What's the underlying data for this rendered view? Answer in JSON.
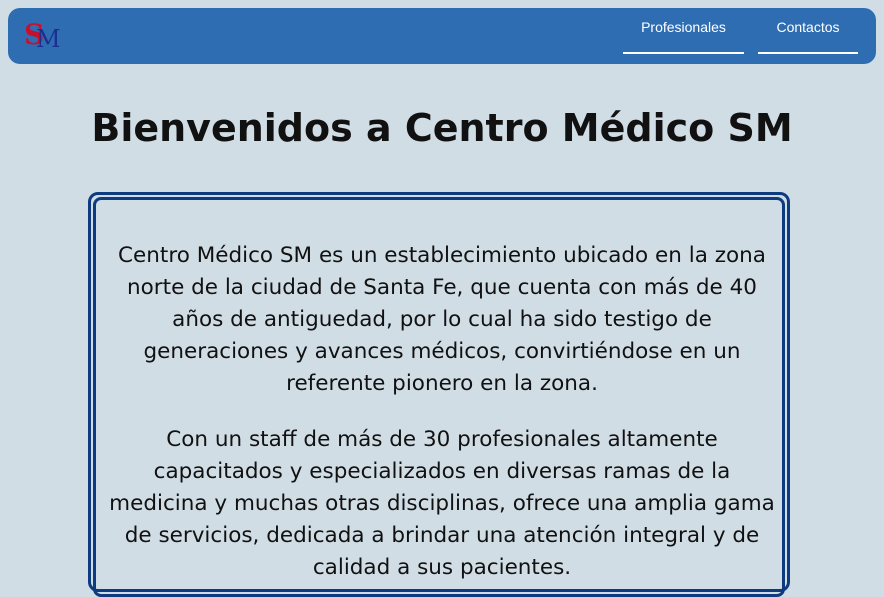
{
  "header": {
    "logo": {
      "letter_s": "S",
      "letter_m": "M",
      "s_color": "#c8102e",
      "m_color": "#1a2f8f"
    },
    "nav": [
      {
        "label": "Profesionales"
      },
      {
        "label": "Contactos"
      }
    ],
    "bar_color": "#2f6db3"
  },
  "main": {
    "title": "Bienvenidos a Centro Médico SM",
    "paragraphs": [
      "Centro Médico SM es un establecimiento ubicado en la zona norte de la ciudad de Santa Fe, que cuenta con más de 40 años de antiguedad, por lo cual ha sido testigo de generaciones y avances médicos, convirtiéndose en un referente pionero en la zona.",
      "Con un staff de más de 30 profesionales altamente capacitados y especializados en diversas ramas de la medicina y muchas otras disciplinas, ofrece una amplia gama de servicios, dedicada a brindar una atención integral y de calidad a sus pacientes."
    ]
  },
  "colors": {
    "background": "#d1dde5",
    "card_border": "#0e3b80"
  }
}
